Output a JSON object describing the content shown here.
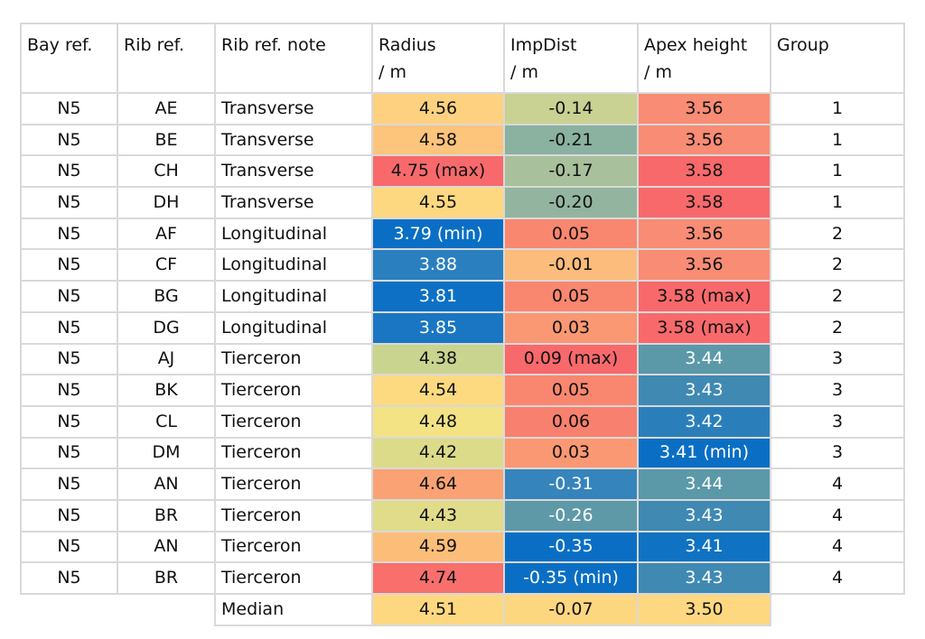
{
  "headers": {
    "bay": "Bay ref.",
    "rib": "Rib ref.",
    "note": "Rib ref. note",
    "radius": [
      "Radius",
      "/ m"
    ],
    "impdist": [
      "ImpDist",
      "/ m"
    ],
    "apex": [
      "Apex height",
      "/ m"
    ],
    "group": "Group"
  },
  "rows": [
    {
      "bay": "N5",
      "rib": "AE",
      "note": "Transverse",
      "radius": "4.56",
      "radius_color": "#fdd17f",
      "radius_light": false,
      "impdist": "-0.14",
      "impdist_color": "#c9d193",
      "impdist_light": false,
      "apex": "3.56",
      "apex_color": "#f88c74",
      "apex_light": false,
      "group": "1"
    },
    {
      "bay": "N5",
      "rib": "BE",
      "note": "Transverse",
      "radius": "4.58",
      "radius_color": "#fdc47c",
      "radius_light": false,
      "impdist": "-0.21",
      "impdist_color": "#8bb1a1",
      "impdist_light": false,
      "apex": "3.56",
      "apex_color": "#f88c74",
      "apex_light": false,
      "group": "1"
    },
    {
      "bay": "N5",
      "rib": "CH",
      "note": "Transverse",
      "radius": "4.75 (max)",
      "radius_color": "#f8696b",
      "radius_light": false,
      "impdist": "-0.17",
      "impdist_color": "#a8c09b",
      "impdist_light": false,
      "apex": "3.58",
      "apex_color": "#f8696b",
      "apex_light": false,
      "group": "1"
    },
    {
      "bay": "N5",
      "rib": "DH",
      "note": "Transverse",
      "radius": "4.55",
      "radius_color": "#fed880",
      "radius_light": false,
      "impdist": "-0.20",
      "impdist_color": "#93b59f",
      "impdist_light": false,
      "apex": "3.58",
      "apex_color": "#f8696b",
      "apex_light": false,
      "group": "1"
    },
    {
      "bay": "N5",
      "rib": "AF",
      "note": "Longitudinal",
      "radius": "3.79 (min)",
      "radius_color": "#0a6fc4",
      "radius_light": true,
      "impdist": "0.05",
      "impdist_color": "#f9876f",
      "impdist_light": false,
      "apex": "3.56",
      "apex_color": "#f88c74",
      "apex_light": false,
      "group": "2"
    },
    {
      "bay": "N5",
      "rib": "CF",
      "note": "Longitudinal",
      "radius": "3.88",
      "radius_color": "#2a7fbf",
      "radius_light": true,
      "impdist": "-0.01",
      "impdist_color": "#fcbc7b",
      "impdist_light": false,
      "apex": "3.56",
      "apex_color": "#f88c74",
      "apex_light": false,
      "group": "2"
    },
    {
      "bay": "N5",
      "rib": "BG",
      "note": "Longitudinal",
      "radius": "3.81",
      "radius_color": "#0d70c4",
      "radius_light": true,
      "impdist": "0.05",
      "impdist_color": "#f9876f",
      "impdist_light": false,
      "apex": "3.58 (max)",
      "apex_color": "#f8696b",
      "apex_light": false,
      "group": "2"
    },
    {
      "bay": "N5",
      "rib": "DG",
      "note": "Longitudinal",
      "radius": "3.85",
      "radius_color": "#1a76c2",
      "radius_light": true,
      "impdist": "0.03",
      "impdist_color": "#fa9873",
      "impdist_light": false,
      "apex": "3.58 (max)",
      "apex_color": "#f8696b",
      "apex_light": false,
      "group": "2"
    },
    {
      "bay": "N5",
      "rib": "AJ",
      "note": "Tierceron",
      "radius": "4.38",
      "radius_color": "#c9d48f",
      "radius_light": false,
      "impdist": "0.09 (max)",
      "impdist_color": "#f8696b",
      "impdist_light": false,
      "apex": "3.44",
      "apex_color": "#5b98a8",
      "apex_light": true,
      "group": "3"
    },
    {
      "bay": "N5",
      "rib": "BK",
      "note": "Tierceron",
      "radius": "4.54",
      "radius_color": "#fdd980",
      "radius_light": false,
      "impdist": "0.05",
      "impdist_color": "#f9876f",
      "impdist_light": false,
      "apex": "3.43",
      "apex_color": "#3f89b3",
      "apex_light": true,
      "group": "3"
    },
    {
      "bay": "N5",
      "rib": "CL",
      "note": "Tierceron",
      "radius": "4.48",
      "radius_color": "#f3e385",
      "radius_light": false,
      "impdist": "0.06",
      "impdist_color": "#f8806e",
      "impdist_light": false,
      "apex": "3.42",
      "apex_color": "#2a7fbb",
      "apex_light": true,
      "group": "3"
    },
    {
      "bay": "N5",
      "rib": "DM",
      "note": "Tierceron",
      "radius": "4.42",
      "radius_color": "#dcdb8a",
      "radius_light": false,
      "impdist": "0.03",
      "impdist_color": "#fa9873",
      "impdist_light": false,
      "apex": "3.41 (min)",
      "apex_color": "#0a6fc4",
      "apex_light": true,
      "group": "3"
    },
    {
      "bay": "N5",
      "rib": "AN",
      "note": "Tierceron",
      "radius": "4.64",
      "radius_color": "#faa273",
      "radius_light": false,
      "impdist": "-0.31",
      "impdist_color": "#3584bb",
      "impdist_light": true,
      "apex": "3.44",
      "apex_color": "#5b98a8",
      "apex_light": true,
      "group": "4"
    },
    {
      "bay": "N5",
      "rib": "BR",
      "note": "Tierceron",
      "radius": "4.43",
      "radius_color": "#e0dc8a",
      "radius_light": false,
      "impdist": "-0.26",
      "impdist_color": "#5e99a8",
      "impdist_light": true,
      "apex": "3.43",
      "apex_color": "#3f89b3",
      "apex_light": true,
      "group": "4"
    },
    {
      "bay": "N5",
      "rib": "AN",
      "note": "Tierceron",
      "radius": "4.59",
      "radius_color": "#fcbd79",
      "radius_light": false,
      "impdist": "-0.35",
      "impdist_color": "#0a6fc4",
      "impdist_light": true,
      "apex": "3.41",
      "apex_color": "#0f72c2",
      "apex_light": true,
      "group": "4"
    },
    {
      "bay": "N5",
      "rib": "BR",
      "note": "Tierceron",
      "radius": "4.74",
      "radius_color": "#f86f6c",
      "radius_light": false,
      "impdist": "-0.35 (min)",
      "impdist_color": "#0a6fc4",
      "impdist_light": true,
      "apex": "3.43",
      "apex_color": "#3f89b3",
      "apex_light": true,
      "group": "4"
    }
  ],
  "median": {
    "label": "Median",
    "radius": "4.51",
    "radius_color": "#fed880",
    "impdist": "-0.07",
    "impdist_color": "#fdd680",
    "apex": "3.50",
    "apex_color": "#fed880"
  }
}
